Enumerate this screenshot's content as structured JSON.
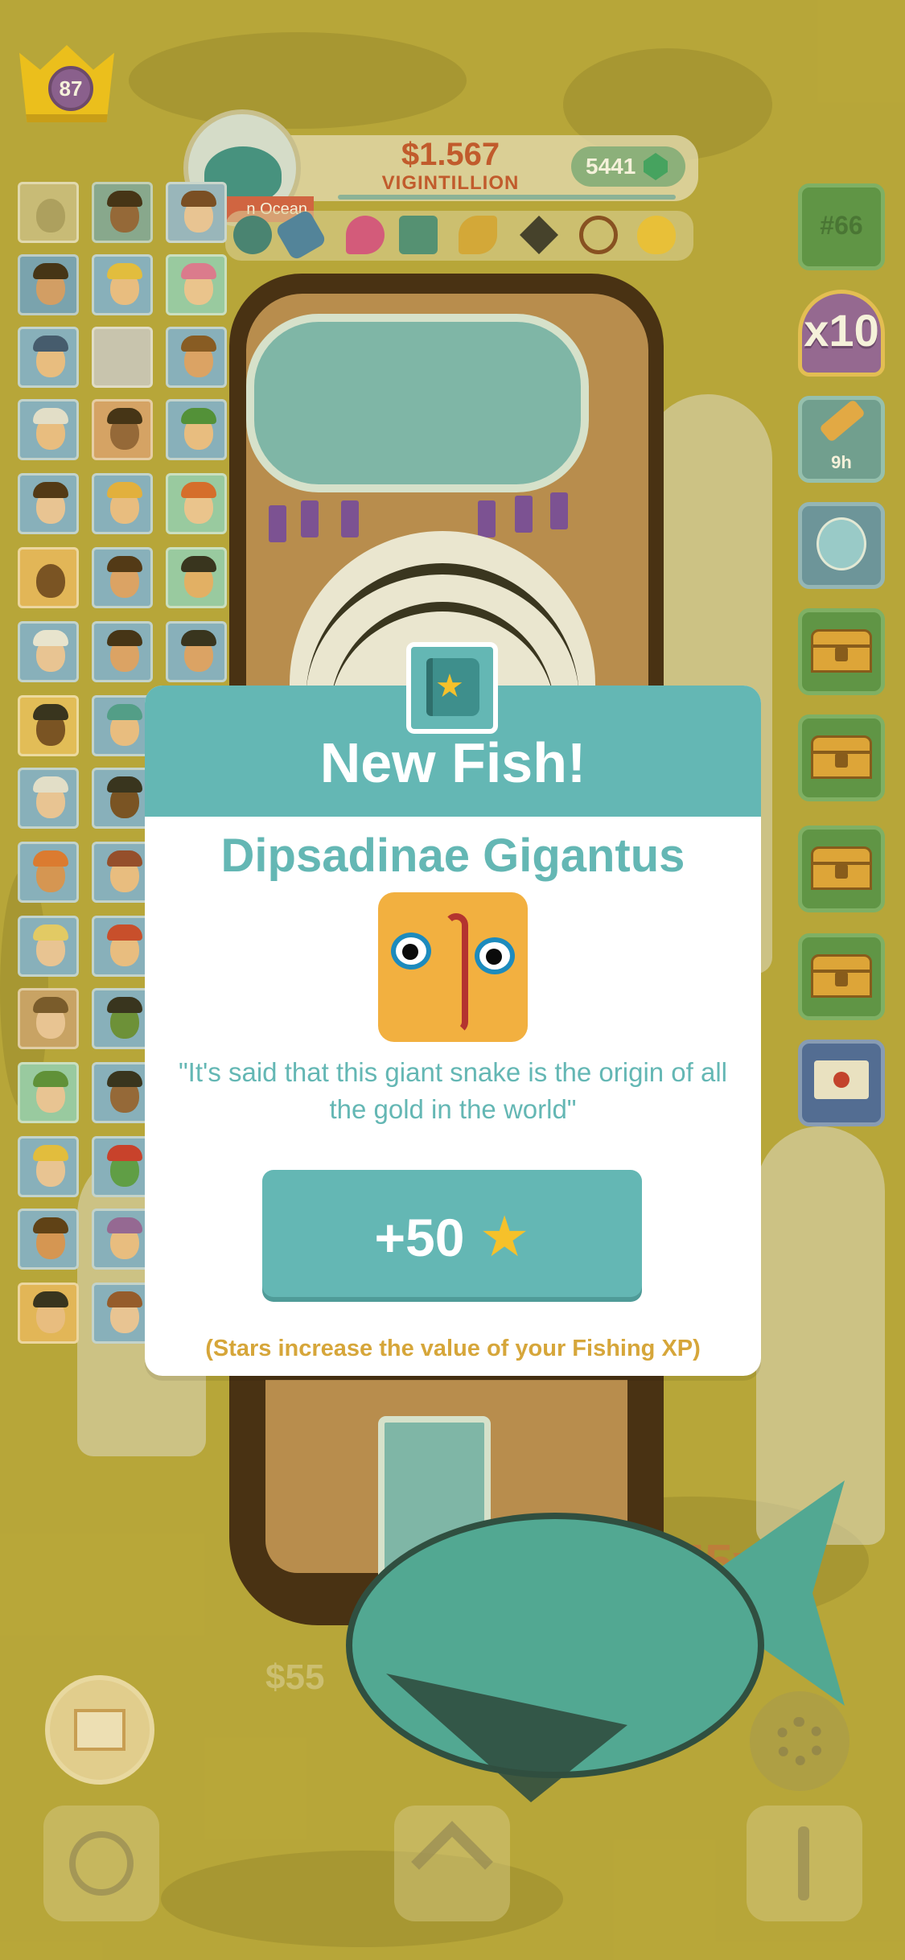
{
  "player": {
    "level": "87"
  },
  "balance": {
    "amount": "$1.567",
    "unit": "VIGINTILLION"
  },
  "gems": {
    "count": "5441"
  },
  "location": {
    "label": "n Ocean"
  },
  "side_buttons": {
    "rank": "#66",
    "multiplier": "x10",
    "telescope_timer": "9h"
  },
  "background": {
    "money_left": "$55",
    "money_right": "55vd"
  },
  "modal": {
    "title": "New Fish!",
    "fish_name": "Dipsadinae Gigantus",
    "description": "\"It's said that this giant snake is the origin of all the gold in the world\"",
    "reward_value": "+50",
    "reward_star": "★",
    "badge_star": "★",
    "footnote": "(Stars increase the value of your Fishing XP)"
  },
  "colors": {
    "modal_teal": "#64b7b4",
    "money_red": "#c0492b",
    "star_gold": "#f6c12a",
    "footnote_gold": "#d6a63a",
    "background_olive": "#b4a43b"
  },
  "icons": [
    "crown-icon",
    "gem-icon",
    "whale-icon",
    "book-star-icon",
    "map-icon",
    "compass-icon",
    "chevron-up-icon",
    "anchor-icon",
    "gear-icon",
    "telescope-icon",
    "fishbowl-icon",
    "treasure-chest-icon",
    "envelope-icon"
  ]
}
